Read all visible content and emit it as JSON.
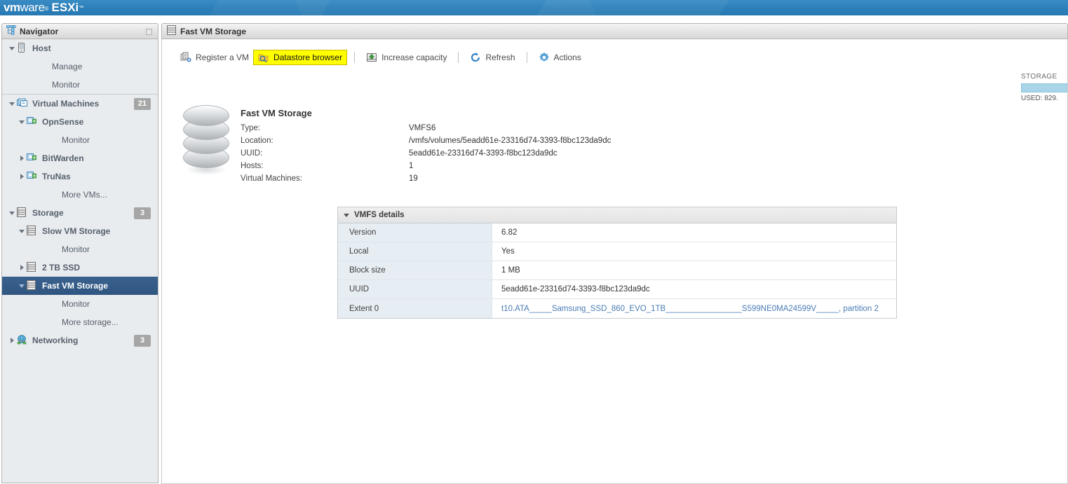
{
  "brand": {
    "vm": "vm",
    "ware": "ware",
    "registered": "®",
    "product": "ESXi",
    "tm": "™"
  },
  "navigator": {
    "title": "Navigator",
    "collapse_icon": "collapse-panel-icon",
    "groups": [
      {
        "items": [
          {
            "label": "Host",
            "icon": "host-icon",
            "twisty": "down",
            "indent": 0,
            "bold": true
          },
          {
            "label": "Manage",
            "icon": "none",
            "twisty": "none",
            "indent": 2,
            "bold": false
          },
          {
            "label": "Monitor",
            "icon": "none",
            "twisty": "none",
            "indent": 2,
            "bold": false
          }
        ]
      },
      {
        "items": [
          {
            "label": "Virtual Machines",
            "icon": "vms-icon",
            "twisty": "down",
            "indent": 0,
            "bold": true,
            "badge": "21"
          },
          {
            "label": "OpnSense",
            "icon": "vm-on-icon",
            "twisty": "down",
            "indent": 1,
            "bold": true
          },
          {
            "label": "Monitor",
            "icon": "none",
            "twisty": "none",
            "indent": 3,
            "bold": false
          },
          {
            "label": "BitWarden",
            "icon": "vm-on-icon",
            "twisty": "right",
            "indent": 1,
            "bold": true
          },
          {
            "label": "TruNas",
            "icon": "vm-on-icon",
            "twisty": "right",
            "indent": 1,
            "bold": true
          },
          {
            "label": "More VMs...",
            "icon": "none",
            "twisty": "none",
            "indent": 3,
            "bold": false
          },
          {
            "label": "Storage",
            "icon": "storage-icon",
            "twisty": "down",
            "indent": 0,
            "bold": true,
            "badge": "3"
          },
          {
            "label": "Slow VM Storage",
            "icon": "datastore-icon",
            "twisty": "down",
            "indent": 1,
            "bold": true
          },
          {
            "label": "Monitor",
            "icon": "none",
            "twisty": "none",
            "indent": 3,
            "bold": false
          },
          {
            "label": "2 TB SSD",
            "icon": "datastore-icon",
            "twisty": "right",
            "indent": 1,
            "bold": true
          },
          {
            "label": "Fast VM Storage",
            "icon": "datastore-icon",
            "twisty": "down",
            "indent": 1,
            "bold": true,
            "selected": true
          },
          {
            "label": "Monitor",
            "icon": "none",
            "twisty": "none",
            "indent": 3,
            "bold": false
          },
          {
            "label": "More storage...",
            "icon": "none",
            "twisty": "none",
            "indent": 3,
            "bold": false
          },
          {
            "label": "Networking",
            "icon": "network-icon",
            "twisty": "right",
            "indent": 0,
            "bold": true,
            "badge": "3"
          }
        ]
      }
    ]
  },
  "content": {
    "tab_title": "Fast VM Storage",
    "tab_icon": "datastore-icon",
    "toolbar": [
      {
        "label": "Register a VM",
        "icon": "register-vm-icon",
        "highlighted": false
      },
      {
        "label": "Datastore browser",
        "icon": "datastore-browser-icon",
        "highlighted": true
      },
      {
        "label": "Increase capacity",
        "icon": "increase-capacity-icon",
        "highlighted": false
      },
      {
        "label": "Refresh",
        "icon": "refresh-icon",
        "highlighted": false
      },
      {
        "label": "Actions",
        "icon": "actions-gear-icon",
        "highlighted": false
      }
    ],
    "storage_gauge": {
      "title": "STORAGE",
      "used_text": "USED: 829.",
      "bar_color": "#a8d5e8"
    },
    "summary": {
      "icon": "datastore-large-icon",
      "title": "Fast VM Storage",
      "fields": [
        {
          "key": "Type:",
          "value": "VMFS6"
        },
        {
          "key": "Location:",
          "value": "/vmfs/volumes/5eadd61e-23316d74-3393-f8bc123da9dc"
        },
        {
          "key": "UUID:",
          "value": "5eadd61e-23316d74-3393-f8bc123da9dc"
        },
        {
          "key": "Hosts:",
          "value": "1"
        },
        {
          "key": "Virtual Machines:",
          "value": "19"
        }
      ]
    },
    "details": {
      "header": "VMFS details",
      "rows": [
        {
          "key": "Version",
          "value": "6.82",
          "link": false
        },
        {
          "key": "Local",
          "value": "Yes",
          "link": false
        },
        {
          "key": "Block size",
          "value": "1 MB",
          "link": false
        },
        {
          "key": "UUID",
          "value": "5eadd61e-23316d74-3393-f8bc123da9dc",
          "link": false
        },
        {
          "key": "Extent 0",
          "value": "t10.ATA_____Samsung_SSD_860_EVO_1TB_________________S599NE0MA24599V_____, partition 2",
          "link": true
        }
      ]
    }
  },
  "colors": {
    "brand_blue": "#2e81bb",
    "selection_blue": "#3a628e",
    "highlight_yellow": "#ffff00",
    "link_blue": "#4a7cb5",
    "badge_gray": "#a6a6a6"
  }
}
